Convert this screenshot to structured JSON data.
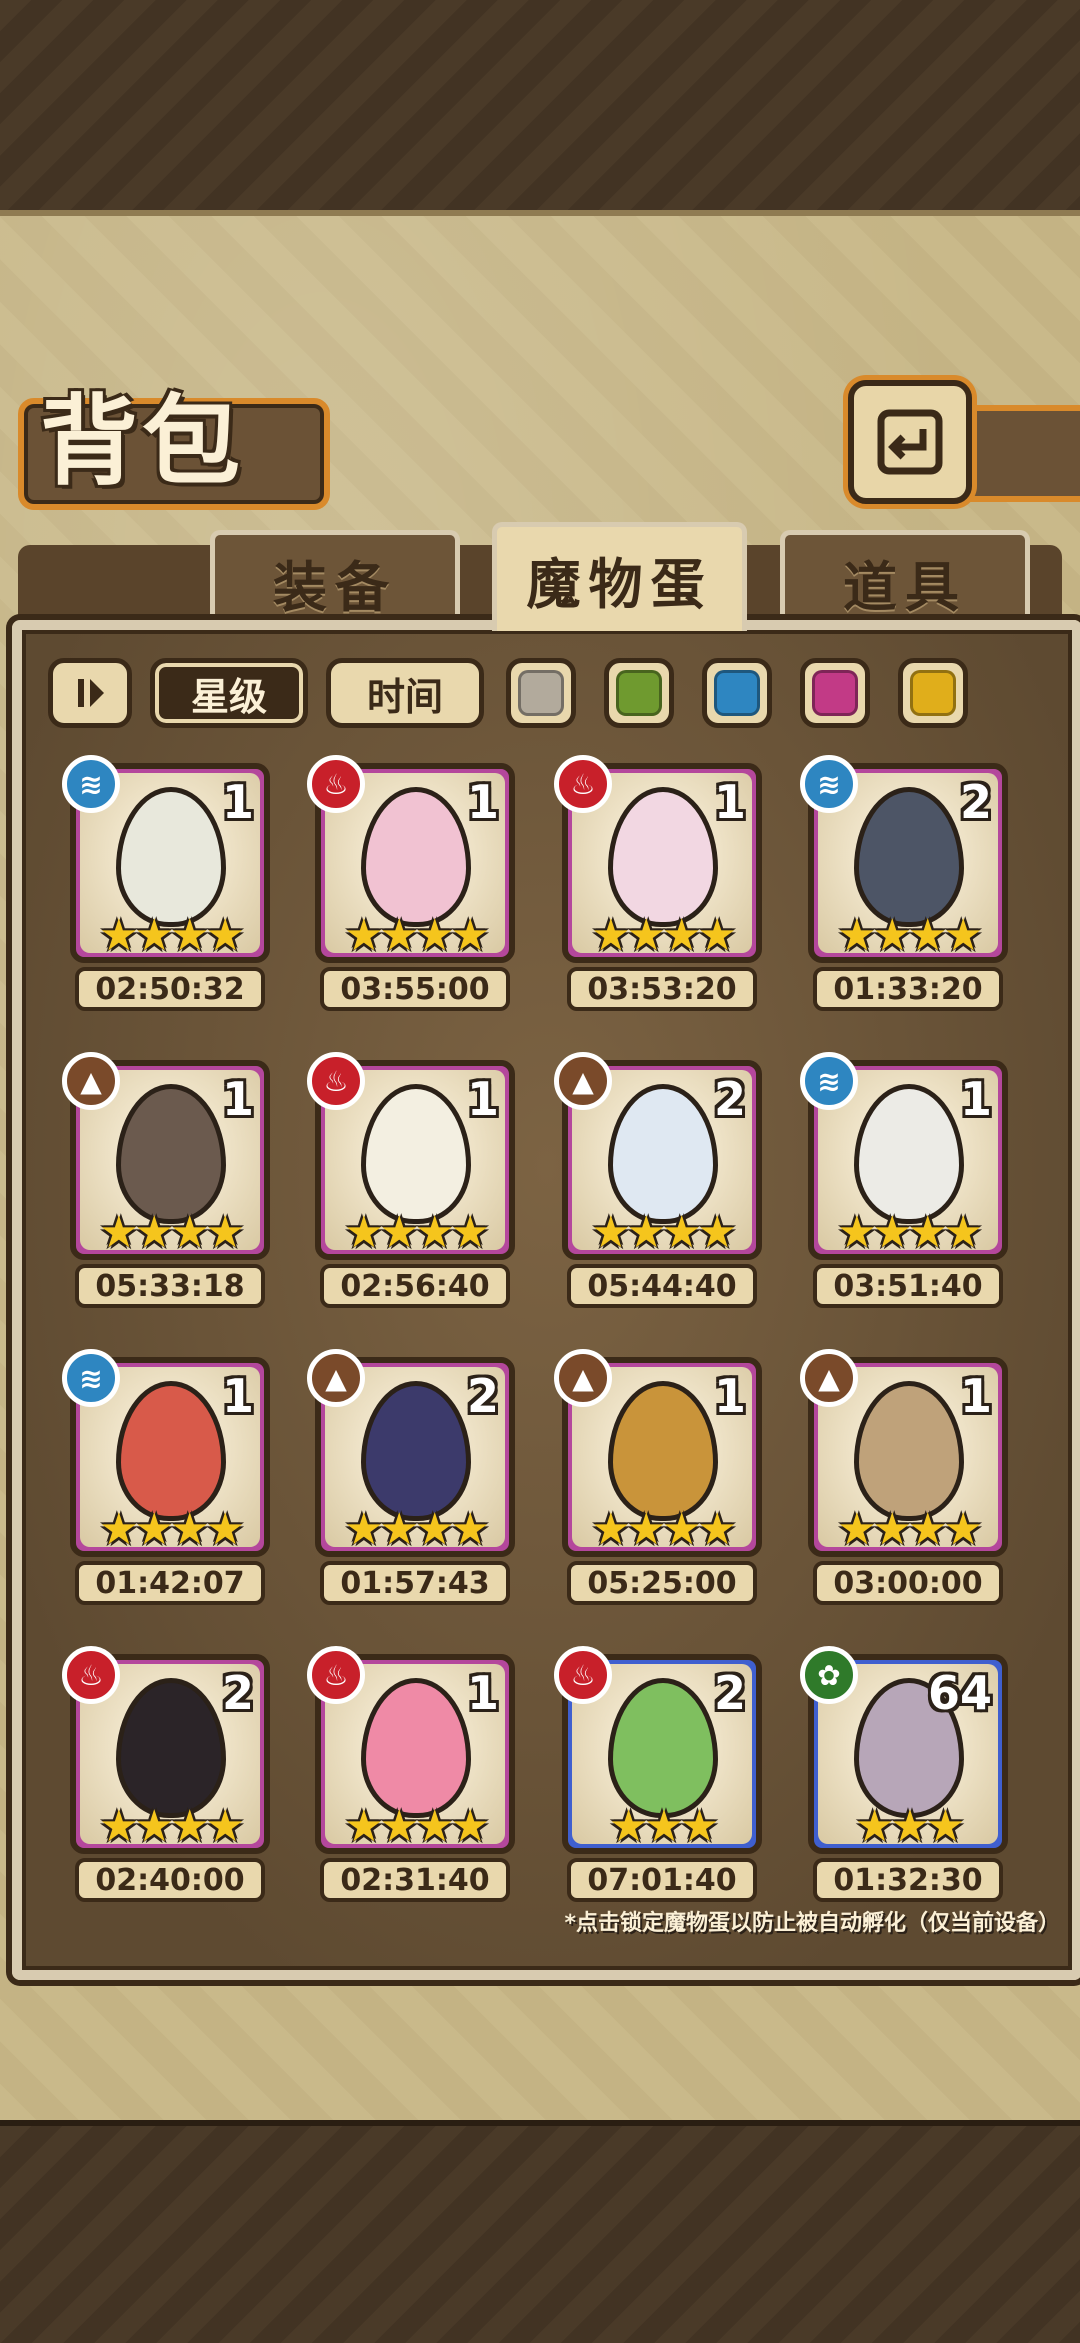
{
  "header": {
    "title": "背包",
    "back_icon": "return-arrow-icon"
  },
  "tabs": [
    {
      "label": "装备",
      "active": false
    },
    {
      "label": "魔物蛋",
      "active": true
    },
    {
      "label": "道具",
      "active": false
    }
  ],
  "toolbar": {
    "order_toggle_icon": "sort-direction-icon",
    "sort_star_label": "星级",
    "sort_time_label": "时间",
    "color_filters": [
      "#b2aa9c",
      "#6f9a2f",
      "#2e86c1",
      "#c23a86",
      "#e0ae1b"
    ]
  },
  "eggs": [
    {
      "element": "water",
      "element_color": "#2e86c1",
      "count": "1",
      "stars": 4,
      "timer": "02:50:32",
      "rarity_color": "#b4479c",
      "egg_color": "#e8e8dc"
    },
    {
      "element": "fire",
      "element_color": "#c8202a",
      "count": "1",
      "stars": 4,
      "timer": "03:55:00",
      "rarity_color": "#b4479c",
      "egg_color": "#f1c2d2"
    },
    {
      "element": "fire",
      "element_color": "#c8202a",
      "count": "1",
      "stars": 4,
      "timer": "03:53:20",
      "rarity_color": "#b4479c",
      "egg_color": "#f2d7e2"
    },
    {
      "element": "water",
      "element_color": "#2e86c1",
      "count": "2",
      "stars": 4,
      "timer": "01:33:20",
      "rarity_color": "#b4479c",
      "egg_color": "#4d5566"
    },
    {
      "element": "earth",
      "element_color": "#7a4a2a",
      "count": "1",
      "stars": 4,
      "timer": "05:33:18",
      "rarity_color": "#b4479c",
      "egg_color": "#6b5a4e"
    },
    {
      "element": "fire",
      "element_color": "#c8202a",
      "count": "1",
      "stars": 4,
      "timer": "02:56:40",
      "rarity_color": "#b4479c",
      "egg_color": "#f3efe1"
    },
    {
      "element": "earth",
      "element_color": "#7a4a2a",
      "count": "2",
      "stars": 4,
      "timer": "05:44:40",
      "rarity_color": "#b4479c",
      "egg_color": "#dfe8f2"
    },
    {
      "element": "water",
      "element_color": "#2e86c1",
      "count": "1",
      "stars": 4,
      "timer": "03:51:40",
      "rarity_color": "#b4479c",
      "egg_color": "#ecebe6"
    },
    {
      "element": "water",
      "element_color": "#2e86c1",
      "count": "1",
      "stars": 4,
      "timer": "01:42:07",
      "rarity_color": "#b4479c",
      "egg_color": "#d85a4a"
    },
    {
      "element": "earth",
      "element_color": "#7a4a2a",
      "count": "2",
      "stars": 4,
      "timer": "01:57:43",
      "rarity_color": "#b4479c",
      "egg_color": "#3c3a6b"
    },
    {
      "element": "earth",
      "element_color": "#7a4a2a",
      "count": "1",
      "stars": 4,
      "timer": "05:25:00",
      "rarity_color": "#b4479c",
      "egg_color": "#c9943a"
    },
    {
      "element": "earth",
      "element_color": "#7a4a2a",
      "count": "1",
      "stars": 4,
      "timer": "03:00:00",
      "rarity_color": "#b4479c",
      "egg_color": "#bfa27a"
    },
    {
      "element": "fire",
      "element_color": "#c8202a",
      "count": "2",
      "stars": 4,
      "timer": "02:40:00",
      "rarity_color": "#b4479c",
      "egg_color": "#2b2428"
    },
    {
      "element": "fire",
      "element_color": "#c8202a",
      "count": "1",
      "stars": 4,
      "timer": "02:31:40",
      "rarity_color": "#b4479c",
      "egg_color": "#ef8aa6"
    },
    {
      "element": "fire",
      "element_color": "#c8202a",
      "count": "2",
      "stars": 3,
      "timer": "07:01:40",
      "rarity_color": "#3f5fcf",
      "egg_color": "#7fbf5f"
    },
    {
      "element": "wood",
      "element_color": "#2f7a2a",
      "count": "64",
      "stars": 3,
      "timer": "01:32:30",
      "rarity_color": "#3f5fcf",
      "egg_color": "#b7a6b8"
    }
  ],
  "footer_note": "*点击锁定魔物蛋以防止被自动孵化（仅当前设备）"
}
